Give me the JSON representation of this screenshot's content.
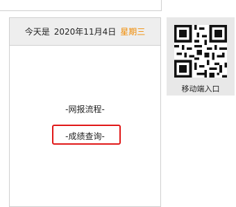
{
  "date_bar": {
    "prefix": "今天是",
    "date": "2020年11月4日",
    "weekday": "星期三",
    "weekday_color": "#f08a00"
  },
  "links": {
    "online_process": "-网报流程-",
    "score_query": "-成绩查询-"
  },
  "highlight": {
    "color": "#e01515"
  },
  "qr": {
    "label": "移动端入口",
    "icon": "qr-code-icon"
  }
}
